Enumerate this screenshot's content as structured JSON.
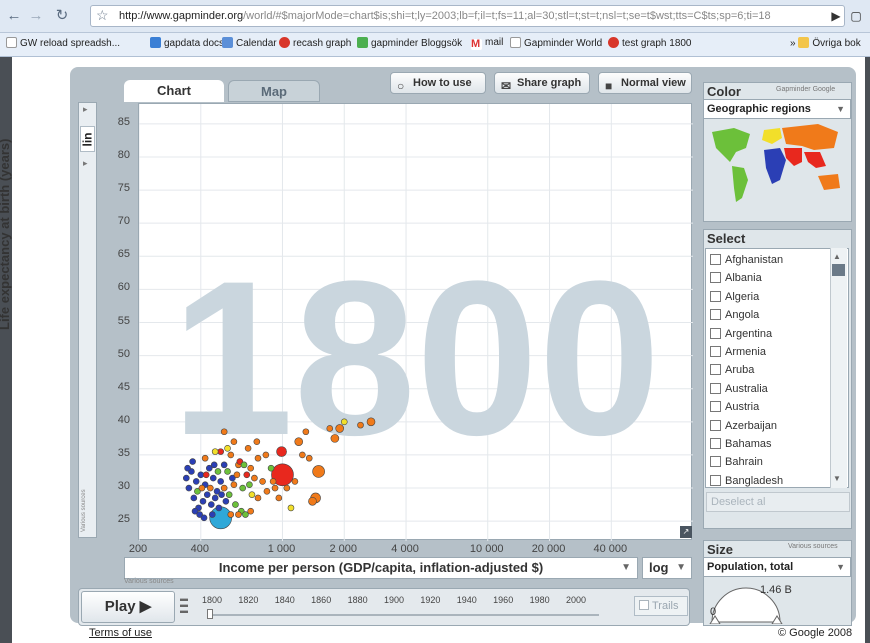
{
  "browser": {
    "url_host": "http://www.gapminder.org",
    "url_rest": "/world/#$majorMode=chart$is;shi=t;ly=2003;lb=f;il=t;fs=11;al=30;stl=t;st=t;nsl=t;se=t$wst;tts=C$ts;sp=6;ti=18",
    "bookmarks": [
      "GW reload spreadsh...",
      "gapdata docs",
      "Calendar",
      "recash graph",
      "gapminder Bloggsök",
      "mail",
      "Gapminder World",
      "test graph 1800"
    ],
    "bookmarks_more": "Övriga bok"
  },
  "tabs": {
    "chart": "Chart",
    "map": "Map"
  },
  "toolbar": {
    "how_to_use": "How to use",
    "share_graph": "Share graph",
    "normal_view": "Normal view"
  },
  "year_watermark": "1800",
  "y_axis": {
    "scale": "lin",
    "title": "Life expectancy at birth (years)",
    "source": "Various sources"
  },
  "x_axis": {
    "title": "Income per person (GDP/capita, inflation-adjusted $)",
    "scale": "log",
    "source": "Various sources"
  },
  "chart_data": {
    "type": "scatter",
    "xscale": "log",
    "xlabel": "Income per person (GDP/capita, inflation-adjusted $)",
    "ylabel": "Life expectancy at birth (years)",
    "xlim": [
      200,
      100000
    ],
    "ylim": [
      22,
      88
    ],
    "xticks": [
      "200",
      "400",
      "1 000",
      "2 000",
      "4 000",
      "10 000",
      "20 000",
      "40 000"
    ],
    "xtick_values": [
      200,
      400,
      1000,
      2000,
      4000,
      10000,
      20000,
      40000
    ],
    "yticks": [
      25,
      30,
      35,
      40,
      45,
      50,
      55,
      60,
      65,
      70,
      75,
      80,
      85
    ],
    "color_legend": {
      "blue": "#2b3fb5",
      "orange": "#f07a1a",
      "red": "#e8281e",
      "green": "#6cc03a",
      "yellow": "#f2df2a",
      "cyan": "#2fa8d8"
    },
    "points": [
      {
        "x": 500,
        "y": 25.5,
        "s": 11,
        "c": "cyan"
      },
      {
        "x": 1000,
        "y": 32,
        "s": 11,
        "c": "red"
      },
      {
        "x": 990,
        "y": 35.5,
        "s": 5,
        "c": "red"
      },
      {
        "x": 1500,
        "y": 32.5,
        "s": 6,
        "c": "orange"
      },
      {
        "x": 1450,
        "y": 28.5,
        "s": 5,
        "c": "orange"
      },
      {
        "x": 1400,
        "y": 28,
        "s": 4,
        "c": "orange"
      },
      {
        "x": 1200,
        "y": 37,
        "s": 4,
        "c": "orange"
      },
      {
        "x": 1800,
        "y": 37.5,
        "s": 4,
        "c": "orange"
      },
      {
        "x": 1900,
        "y": 39,
        "s": 4,
        "c": "orange"
      },
      {
        "x": 2700,
        "y": 40,
        "s": 4,
        "c": "orange"
      },
      {
        "x": 2400,
        "y": 39.5,
        "s": 3,
        "c": "orange"
      },
      {
        "x": 2000,
        "y": 40,
        "s": 3,
        "c": "yellow"
      },
      {
        "x": 1700,
        "y": 39,
        "s": 3,
        "c": "orange"
      },
      {
        "x": 1300,
        "y": 38.5,
        "s": 3,
        "c": "orange"
      },
      {
        "x": 1100,
        "y": 27,
        "s": 3,
        "c": "yellow"
      },
      {
        "x": 830,
        "y": 35,
        "s": 3,
        "c": "orange"
      },
      {
        "x": 760,
        "y": 34.5,
        "s": 3,
        "c": "orange"
      },
      {
        "x": 700,
        "y": 33,
        "s": 3,
        "c": "orange"
      },
      {
        "x": 880,
        "y": 33,
        "s": 3,
        "c": "green"
      },
      {
        "x": 900,
        "y": 31,
        "s": 3,
        "c": "orange"
      },
      {
        "x": 800,
        "y": 31,
        "s": 3,
        "c": "orange"
      },
      {
        "x": 730,
        "y": 31.5,
        "s": 3,
        "c": "orange"
      },
      {
        "x": 670,
        "y": 32,
        "s": 3,
        "c": "red"
      },
      {
        "x": 640,
        "y": 30,
        "s": 3,
        "c": "green"
      },
      {
        "x": 610,
        "y": 33.5,
        "s": 3,
        "c": "orange"
      },
      {
        "x": 580,
        "y": 30.5,
        "s": 3,
        "c": "orange"
      },
      {
        "x": 560,
        "y": 35,
        "s": 3,
        "c": "orange"
      },
      {
        "x": 540,
        "y": 32.5,
        "s": 3,
        "c": "green"
      },
      {
        "x": 520,
        "y": 30,
        "s": 3,
        "c": "orange"
      },
      {
        "x": 590,
        "y": 27.5,
        "s": 3,
        "c": "green"
      },
      {
        "x": 630,
        "y": 26.5,
        "s": 3,
        "c": "green"
      },
      {
        "x": 560,
        "y": 26,
        "s": 3,
        "c": "orange"
      },
      {
        "x": 540,
        "y": 36,
        "s": 3,
        "c": "yellow"
      },
      {
        "x": 680,
        "y": 36,
        "s": 3,
        "c": "orange"
      },
      {
        "x": 750,
        "y": 37,
        "s": 3,
        "c": "orange"
      },
      {
        "x": 710,
        "y": 29,
        "s": 3,
        "c": "yellow"
      },
      {
        "x": 760,
        "y": 28.5,
        "s": 3,
        "c": "orange"
      },
      {
        "x": 840,
        "y": 29.5,
        "s": 3,
        "c": "orange"
      },
      {
        "x": 920,
        "y": 30,
        "s": 3,
        "c": "orange"
      },
      {
        "x": 960,
        "y": 28.5,
        "s": 3,
        "c": "orange"
      },
      {
        "x": 1050,
        "y": 30,
        "s": 3,
        "c": "orange"
      },
      {
        "x": 1150,
        "y": 31,
        "s": 3,
        "c": "orange"
      },
      {
        "x": 1250,
        "y": 35,
        "s": 3,
        "c": "orange"
      },
      {
        "x": 1350,
        "y": 34.5,
        "s": 3,
        "c": "orange"
      },
      {
        "x": 380,
        "y": 31,
        "s": 3,
        "c": "blue"
      },
      {
        "x": 400,
        "y": 32,
        "s": 3,
        "c": "blue"
      },
      {
        "x": 420,
        "y": 30.5,
        "s": 3,
        "c": "blue"
      },
      {
        "x": 440,
        "y": 33,
        "s": 3,
        "c": "blue"
      },
      {
        "x": 460,
        "y": 31.5,
        "s": 3,
        "c": "blue"
      },
      {
        "x": 480,
        "y": 29.5,
        "s": 3,
        "c": "blue"
      },
      {
        "x": 500,
        "y": 31,
        "s": 3,
        "c": "blue"
      },
      {
        "x": 520,
        "y": 33.5,
        "s": 3,
        "c": "blue"
      },
      {
        "x": 360,
        "y": 32.5,
        "s": 3,
        "c": "blue"
      },
      {
        "x": 350,
        "y": 30,
        "s": 3,
        "c": "blue"
      },
      {
        "x": 370,
        "y": 28.5,
        "s": 3,
        "c": "blue"
      },
      {
        "x": 390,
        "y": 27,
        "s": 3,
        "c": "blue"
      },
      {
        "x": 410,
        "y": 28,
        "s": 3,
        "c": "blue"
      },
      {
        "x": 430,
        "y": 29,
        "s": 3,
        "c": "blue"
      },
      {
        "x": 450,
        "y": 27.5,
        "s": 3,
        "c": "blue"
      },
      {
        "x": 470,
        "y": 28.5,
        "s": 3,
        "c": "blue"
      },
      {
        "x": 490,
        "y": 27,
        "s": 3,
        "c": "blue"
      },
      {
        "x": 340,
        "y": 31.5,
        "s": 3,
        "c": "blue"
      },
      {
        "x": 345,
        "y": 33,
        "s": 3,
        "c": "blue"
      },
      {
        "x": 365,
        "y": 34,
        "s": 3,
        "c": "blue"
      },
      {
        "x": 385,
        "y": 29.5,
        "s": 3,
        "c": "green"
      },
      {
        "x": 405,
        "y": 30,
        "s": 3,
        "c": "orange"
      },
      {
        "x": 425,
        "y": 32,
        "s": 3,
        "c": "red"
      },
      {
        "x": 445,
        "y": 30,
        "s": 3,
        "c": "orange"
      },
      {
        "x": 465,
        "y": 33.5,
        "s": 3,
        "c": "blue"
      },
      {
        "x": 485,
        "y": 32.5,
        "s": 3,
        "c": "green"
      },
      {
        "x": 505,
        "y": 29,
        "s": 3,
        "c": "blue"
      },
      {
        "x": 530,
        "y": 28,
        "s": 3,
        "c": "blue"
      },
      {
        "x": 550,
        "y": 29,
        "s": 3,
        "c": "green"
      },
      {
        "x": 570,
        "y": 31.5,
        "s": 3,
        "c": "blue"
      },
      {
        "x": 600,
        "y": 32,
        "s": 3,
        "c": "orange"
      },
      {
        "x": 620,
        "y": 34,
        "s": 3,
        "c": "red"
      },
      {
        "x": 650,
        "y": 33.5,
        "s": 3,
        "c": "green"
      },
      {
        "x": 690,
        "y": 30.5,
        "s": 3,
        "c": "green"
      },
      {
        "x": 375,
        "y": 26.5,
        "s": 3,
        "c": "blue"
      },
      {
        "x": 395,
        "y": 26,
        "s": 3,
        "c": "blue"
      },
      {
        "x": 415,
        "y": 25.5,
        "s": 3,
        "c": "blue"
      },
      {
        "x": 455,
        "y": 26,
        "s": 3,
        "c": "blue"
      },
      {
        "x": 610,
        "y": 26,
        "s": 3,
        "c": "orange"
      },
      {
        "x": 660,
        "y": 26,
        "s": 3,
        "c": "green"
      },
      {
        "x": 700,
        "y": 26.5,
        "s": 3,
        "c": "orange"
      },
      {
        "x": 420,
        "y": 34.5,
        "s": 3,
        "c": "orange"
      },
      {
        "x": 500,
        "y": 35.5,
        "s": 3,
        "c": "red"
      },
      {
        "x": 580,
        "y": 37,
        "s": 3,
        "c": "orange"
      },
      {
        "x": 520,
        "y": 38.5,
        "s": 3,
        "c": "orange"
      },
      {
        "x": 470,
        "y": 35.5,
        "s": 3,
        "c": "yellow"
      }
    ]
  },
  "play": {
    "label": "Play",
    "years": [
      "1800",
      "1820",
      "1840",
      "1860",
      "1880",
      "1900",
      "1920",
      "1940",
      "1960",
      "1980",
      "2000"
    ],
    "current_year": 1800,
    "trails_label": "Trails"
  },
  "color_panel": {
    "title": "Color",
    "source": "Gapminder Google",
    "selected": "Geographic regions"
  },
  "select_panel": {
    "title": "Select",
    "countries": [
      "Afghanistan",
      "Albania",
      "Algeria",
      "Angola",
      "Argentina",
      "Armenia",
      "Aruba",
      "Australia",
      "Austria",
      "Azerbaijan",
      "Bahamas",
      "Bahrain",
      "Bangladesh"
    ],
    "deselect_label": "Deselect al"
  },
  "size_panel": {
    "title": "Size",
    "source": "Various sources",
    "selected": "Population, total",
    "max_value": "1.46 B",
    "min_value": "0"
  },
  "footer": {
    "terms": "Terms of use",
    "copyright": "© Google 2008"
  }
}
